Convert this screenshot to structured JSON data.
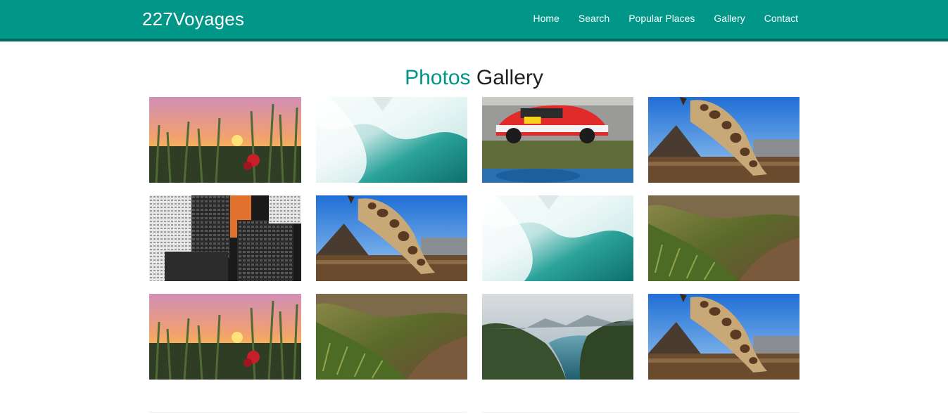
{
  "navbar": {
    "brand": "227Voyages",
    "links": [
      "Home",
      "Search",
      "Popular Places",
      "Gallery",
      "Contact"
    ],
    "color": "#009688"
  },
  "gallery": {
    "title_accent": "Photos",
    "title_rest": "Gallery",
    "photos": [
      "sunset-wheat-field",
      "ocean-wave-surf",
      "race-car",
      "giraffe",
      "city-skyscrapers",
      "giraffe",
      "ocean-wave-surf",
      "grassy-hillside-path",
      "sunset-wheat-field",
      "grassy-hillside-path",
      "mountain-fjord-lake",
      "giraffe"
    ]
  }
}
